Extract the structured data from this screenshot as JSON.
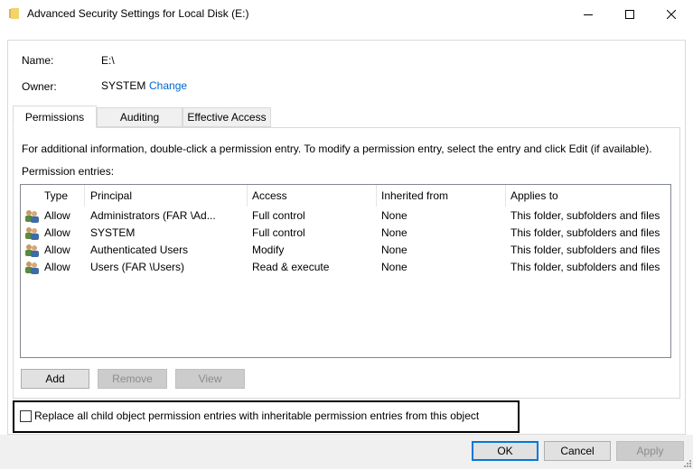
{
  "window": {
    "title": "Advanced Security Settings for Local Disk (E:)",
    "minimize_icon": "minimize-icon",
    "maximize_icon": "maximize-icon",
    "close_icon": "close-icon"
  },
  "info": {
    "name_label": "Name:",
    "name_value": "E:\\",
    "owner_label": "Owner:",
    "owner_value": "SYSTEM",
    "change_link": "Change"
  },
  "tabs": [
    {
      "label": "Permissions",
      "active": true
    },
    {
      "label": "Auditing",
      "active": false
    },
    {
      "label": "Effective Access",
      "active": false
    }
  ],
  "instructions": "For additional information, double-click a permission entry. To modify a permission entry, select the entry and click Edit (if available).",
  "entries_label": "Permission entries:",
  "table": {
    "columns": [
      "Type",
      "Principal",
      "Access",
      "Inherited from",
      "Applies to"
    ],
    "rows": [
      {
        "icon": "users-icon",
        "type": "Allow",
        "principal": "Administrators (FAR \\Ad...",
        "access": "Full control",
        "inherited": "None",
        "applies": "This folder, subfolders and files"
      },
      {
        "icon": "users-icon",
        "type": "Allow",
        "principal": "SYSTEM",
        "access": "Full control",
        "inherited": "None",
        "applies": "This folder, subfolders and files"
      },
      {
        "icon": "users-icon",
        "type": "Allow",
        "principal": "Authenticated Users",
        "access": "Modify",
        "inherited": "None",
        "applies": "This folder, subfolders and files"
      },
      {
        "icon": "users-icon",
        "type": "Allow",
        "principal": "Users (FAR \\Users)",
        "access": "Read & execute",
        "inherited": "None",
        "applies": "This folder, subfolders and files"
      }
    ]
  },
  "buttons": {
    "add": "Add",
    "remove": "Remove",
    "view": "View"
  },
  "checkbox": {
    "label": "Replace all child object permission entries with inheritable permission entries from this object",
    "checked": false
  },
  "footer": {
    "ok": "OK",
    "cancel": "Cancel",
    "apply": "Apply"
  },
  "colors": {
    "link": "#0066cc",
    "default_button_border": "#0078d7",
    "highlight_border": "#000000"
  }
}
